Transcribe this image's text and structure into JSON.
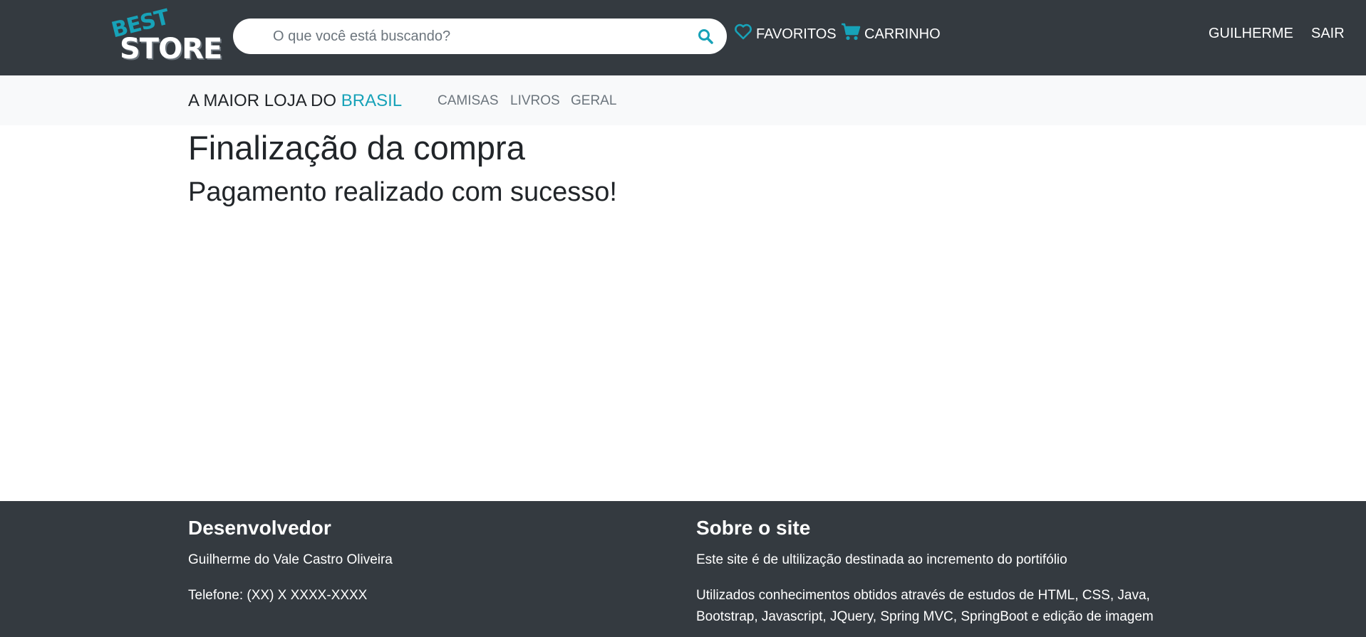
{
  "header": {
    "logo": {
      "line1": "BEST",
      "line2": "STORE"
    },
    "search": {
      "placeholder": "O que você está buscando?",
      "value": "",
      "icon": "search-icon"
    },
    "favorites": {
      "label": "FAVORITOS",
      "icon": "heart-icon"
    },
    "cart": {
      "label": "CARRINHO",
      "icon": "cart-icon"
    },
    "user": {
      "label": "GUILHERME"
    },
    "logout": {
      "label": "SAIR"
    }
  },
  "subnav": {
    "tagline_prefix": "A MAIOR LOJA DO ",
    "tagline_accent": "BRASIL",
    "categories": [
      "CAMISAS",
      "LIVROS",
      "GERAL"
    ]
  },
  "main": {
    "title": "Finalização da compra",
    "subtitle": "Pagamento realizado com sucesso!"
  },
  "footer": {
    "developer": {
      "heading": "Desenvolvedor",
      "name": "Guilherme do Vale Castro Oliveira",
      "phone": "Telefone: (XX) X XXXX-XXXX"
    },
    "about": {
      "heading": "Sobre o site",
      "line1": "Este site é de ultilização destinada ao incremento do portifólio",
      "line2": "Utilizados conhecimentos obtidos através de estudos de HTML, CSS, Java, Bootstrap, Javascript, JQuery, Spring MVC, SpringBoot e edição de imagem"
    }
  },
  "colors": {
    "navbar": "#343a40",
    "accent": "#17a2b8",
    "subnav": "#f8f9fa"
  }
}
